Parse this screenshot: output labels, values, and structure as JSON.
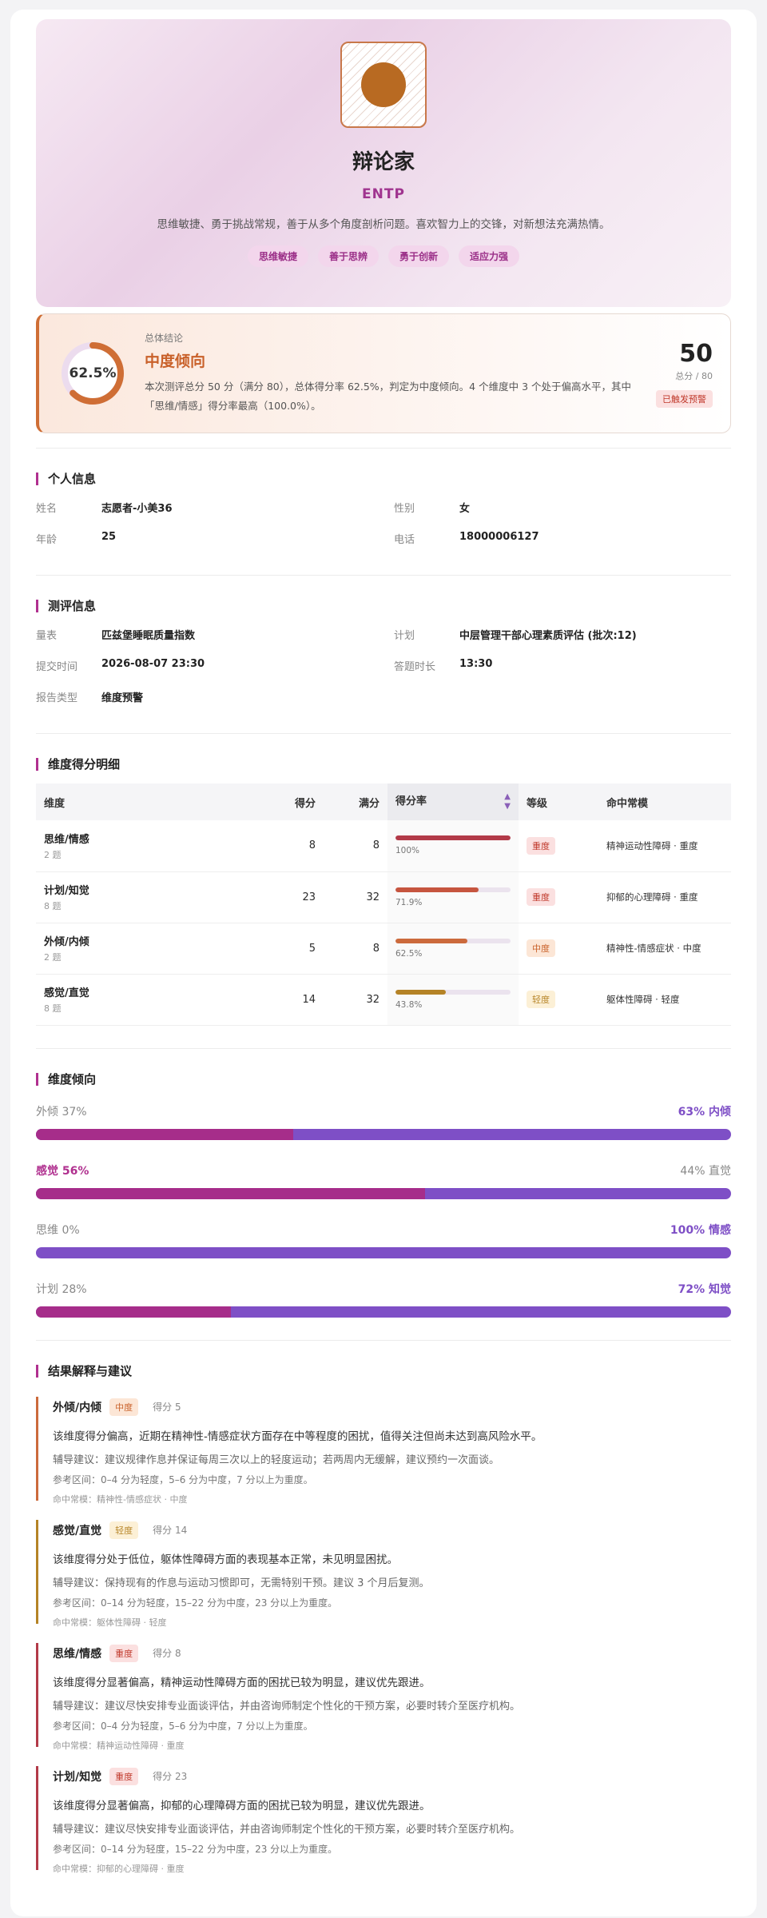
{
  "hero": {
    "title": "辩论家",
    "code": "ENTP",
    "desc": "思维敏捷、勇于挑战常规，善于从多个角度剖析问题。喜欢智力上的交锋，对新想法充满热情。",
    "tags": [
      "思维敏捷",
      "善于思辨",
      "勇于创新",
      "适应力强"
    ]
  },
  "summary": {
    "percent_text": "62.5%",
    "percent": 62.5,
    "label": "总体结论",
    "level": "中度倾向",
    "text": "本次测评总分 50 分（满分 80），总体得分率 62.5%，判定为中度倾向。4 个维度中 3 个处于偏高水平，其中「思维/情感」得分率最高（100.0%）。",
    "score": "50",
    "score_sub": "总分 / 80",
    "warning": "已触发预警"
  },
  "personal": {
    "title": "个人信息",
    "items": [
      {
        "k": "姓名",
        "v": "志愿者-小美36"
      },
      {
        "k": "性别",
        "v": "女"
      },
      {
        "k": "年龄",
        "v": "25"
      },
      {
        "k": "电话",
        "v": "18000006127"
      }
    ]
  },
  "assessment": {
    "title": "测评信息",
    "items": [
      {
        "k": "量表",
        "v": "匹兹堡睡眠质量指数"
      },
      {
        "k": "计划",
        "v": "中层管理干部心理素质评估 (批次:12)"
      },
      {
        "k": "提交时间",
        "v": "2026-08-07 23:30"
      },
      {
        "k": "答题时长",
        "v": "13:30"
      },
      {
        "k": "报告类型",
        "v": "维度预警"
      }
    ]
  },
  "dimensions": {
    "title": "维度得分明细",
    "headers": [
      "维度",
      "得分",
      "满分",
      "得分率",
      "等级",
      "命中常模"
    ],
    "rows": [
      {
        "name": "思维/情感",
        "count": "2 题",
        "score": "8",
        "full": "8",
        "rate": 100,
        "rate_text": "100%",
        "bar_color": "#b23a48",
        "level": "重度",
        "level_bg": "#fbe0e0",
        "level_fg": "#c0392b",
        "hit": "精神运动性障碍 · 重度"
      },
      {
        "name": "计划/知觉",
        "count": "8 题",
        "score": "23",
        "full": "32",
        "rate": 71.9,
        "rate_text": "71.9%",
        "bar_color": "#c6553f",
        "level": "重度",
        "level_bg": "#fbe0e0",
        "level_fg": "#c0392b",
        "hit": "抑郁的心理障碍 · 重度"
      },
      {
        "name": "外倾/内倾",
        "count": "2 题",
        "score": "5",
        "full": "8",
        "rate": 62.5,
        "rate_text": "62.5%",
        "bar_color": "#cc6a3c",
        "level": "中度",
        "level_bg": "#fce6d6",
        "level_fg": "#c9612a",
        "hit": "精神性-情感症状 · 中度"
      },
      {
        "name": "感觉/直觉",
        "count": "8 题",
        "score": "14",
        "full": "32",
        "rate": 43.8,
        "rate_text": "43.8%",
        "bar_color": "#b58326",
        "level": "轻度",
        "level_bg": "#fcf0d6",
        "level_fg": "#b7862a",
        "hit": "躯体性障碍 · 轻度"
      }
    ]
  },
  "tendency": {
    "title": "维度倾向",
    "rows": [
      {
        "left": "外倾 37%",
        "right": "63% 内倾",
        "left_pct": 37,
        "strong": "right"
      },
      {
        "left": "感觉 56%",
        "right": "44% 直觉",
        "left_pct": 56,
        "strong": "left"
      },
      {
        "left": "思维 0%",
        "right": "100% 情感",
        "left_pct": 0,
        "strong": "right"
      },
      {
        "left": "计划 28%",
        "right": "72% 知觉",
        "left_pct": 28,
        "strong": "right"
      }
    ]
  },
  "results": {
    "title": "结果解释与建议",
    "items": [
      {
        "name": "外倾/内倾",
        "level": "中度",
        "level_bg": "#fce6d6",
        "level_fg": "#c9612a",
        "border": "#cc6a3c",
        "score": "得分 5",
        "line1": "该维度得分偏高，近期在精神性-情感症状方面存在中等程度的困扰，值得关注但尚未达到高风险水平。",
        "line2": "辅导建议：建议规律作息并保证每周三次以上的轻度运动；若两周内无缓解，建议预约一次面谈。",
        "line3": "参考区间：0–4 分为轻度，5–6 分为中度，7 分以上为重度。",
        "line4": "命中常模：精神性-情感症状 · 中度"
      },
      {
        "name": "感觉/直觉",
        "level": "轻度",
        "level_bg": "#fcf0d6",
        "level_fg": "#b7862a",
        "border": "#b58326",
        "score": "得分 14",
        "line1": "该维度得分处于低位，躯体性障碍方面的表现基本正常，未见明显困扰。",
        "line2": "辅导建议：保持现有的作息与运动习惯即可，无需特别干预。建议 3 个月后复测。",
        "line3": "参考区间：0–14 分为轻度，15–22 分为中度，23 分以上为重度。",
        "line4": "命中常模：躯体性障碍 · 轻度"
      },
      {
        "name": "思维/情感",
        "level": "重度",
        "level_bg": "#fbe0e0",
        "level_fg": "#c0392b",
        "border": "#b23a48",
        "score": "得分 8",
        "line1": "该维度得分显著偏高，精神运动性障碍方面的困扰已较为明显，建议优先跟进。",
        "line2": "辅导建议：建议尽快安排专业面谈评估，并由咨询师制定个性化的干预方案，必要时转介至医疗机构。",
        "line3": "参考区间：0–4 分为轻度，5–6 分为中度，7 分以上为重度。",
        "line4": "命中常模：精神运动性障碍 · 重度"
      },
      {
        "name": "计划/知觉",
        "level": "重度",
        "level_bg": "#fbe0e0",
        "level_fg": "#c0392b",
        "border": "#b23a48",
        "score": "得分 23",
        "line1": "该维度得分显著偏高，抑郁的心理障碍方面的困扰已较为明显，建议优先跟进。",
        "line2": "辅导建议：建议尽快安排专业面谈评估，并由咨询师制定个性化的干预方案，必要时转介至医疗机构。",
        "line3": "参考区间：0–14 分为轻度，15–22 分为中度，23 分以上为重度。",
        "line4": "命中常模：抑郁的心理障碍 · 重度"
      }
    ]
  },
  "colors": {
    "accent": "#a0348f",
    "summary": "#c9612a",
    "ring_track": "#ecdcee",
    "ring_fill": "#cf6e35",
    "tend_left": "#a62d8a",
    "tend_right": "#7e4fc6"
  },
  "icons": {
    "avatar": "type-avatar-icon",
    "sort": "sort-icon"
  }
}
